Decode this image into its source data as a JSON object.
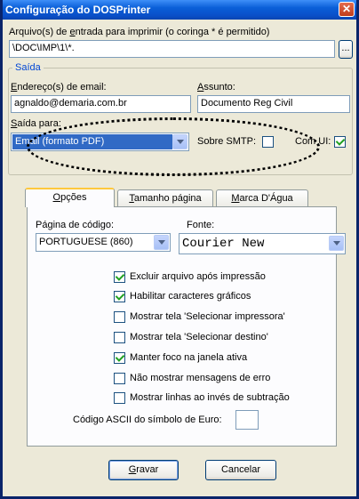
{
  "window": {
    "title": "Configuração do DOSPrinter",
    "close_glyph": "✕"
  },
  "input_files": {
    "label_pre": "Arquivo(s) de ",
    "label_u": "e",
    "label_post": "ntrada para imprimir (o coringa * é permitido)",
    "value": "\\DOC\\IMP\\1\\*.",
    "browse_label": "..."
  },
  "saida": {
    "caption": "Saída",
    "email_label_u": "E",
    "email_label_rest": "ndereço(s) de email:",
    "email_value": "agnaldo@demaria.com.br",
    "subject_label_u": "A",
    "subject_label_rest": "ssunto:",
    "subject_value": "Documento Reg Civil",
    "output_label_u": "S",
    "output_label_rest": "aída para:",
    "output_value": "Email  (formato PDF)",
    "smtp_label": "Sobre SMTP:",
    "smtp_checked": false,
    "comui_label": "Com UI:",
    "comui_checked": true
  },
  "tabs": [
    {
      "label_u": "O",
      "label_rest": "pções",
      "active": true
    },
    {
      "label_u": "T",
      "label_rest": "amanho página",
      "active": false
    },
    {
      "label_u": "M",
      "label_rest": "arca D'Água",
      "active": false
    }
  ],
  "options": {
    "codepage_label": "Página de código:",
    "codepage_value": "PORTUGUESE (860)",
    "font_label": "Fonte:",
    "font_value": "Courier New",
    "checkboxes": [
      {
        "label": "Excluir arquivo após impressão",
        "checked": true
      },
      {
        "label": "Habilitar caracteres gráficos",
        "checked": true
      },
      {
        "label": "Mostrar tela 'Selecionar impressora'",
        "checked": false
      },
      {
        "label": "Mostrar tela 'Selecionar destino'",
        "checked": false
      },
      {
        "label": "Manter foco na janela ativa",
        "checked": true
      },
      {
        "label": "Não mostrar mensagens de erro",
        "checked": false
      },
      {
        "label": "Mostrar linhas ao invés de subtração",
        "checked": false
      }
    ],
    "euro_label": "Código ASCII do símbolo de Euro:",
    "euro_value": ""
  },
  "buttons": {
    "save_u": "G",
    "save_rest": "ravar",
    "cancel": "Cancelar"
  }
}
